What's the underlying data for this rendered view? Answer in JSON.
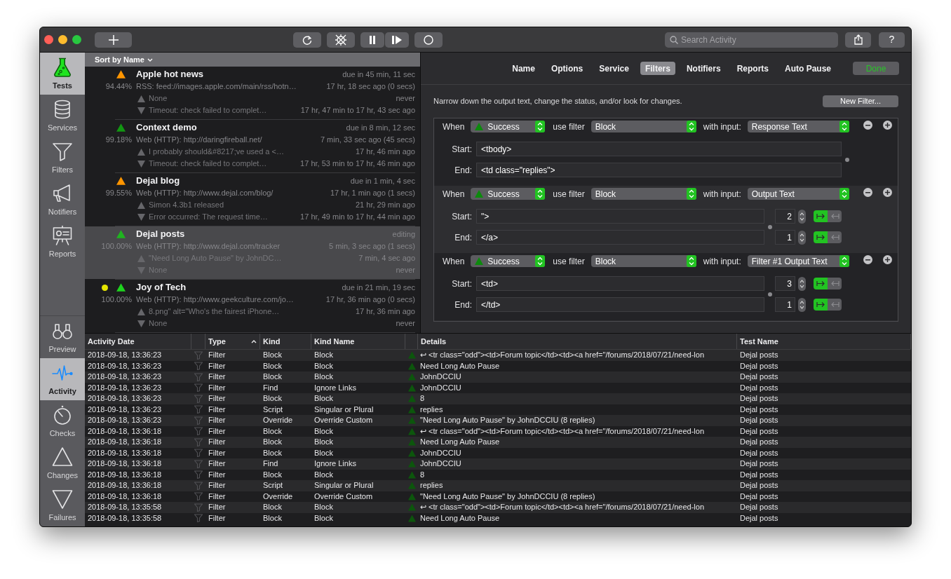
{
  "window": {
    "toolbar": {
      "search": {
        "placeholder": "Search Activity"
      },
      "help_label": "?"
    }
  },
  "sidebar": {
    "top_items": [
      {
        "label": "Tests",
        "selected": true
      },
      {
        "label": "Services",
        "selected": false
      },
      {
        "label": "Filters",
        "selected": false
      },
      {
        "label": "Notifiers",
        "selected": false
      },
      {
        "label": "Reports",
        "selected": false
      }
    ],
    "bottom_items": [
      {
        "label": "Preview",
        "selected": false
      },
      {
        "label": "Activity",
        "selected": true
      },
      {
        "label": "Checks",
        "selected": false
      },
      {
        "label": "Changes",
        "selected": false
      },
      {
        "label": "Failures",
        "selected": false
      }
    ]
  },
  "test_list": {
    "sort_label": "Sort by Name",
    "tests": [
      {
        "name": "Apple hot news",
        "color": "#ff9500",
        "marked": false,
        "selected": false,
        "percent": "94.44%",
        "schedule": "due in 45 min, 11 sec",
        "service": "RSS: feed://images.apple.com/main/rss/hotn…",
        "last_check": "17 hr, 18 sec ago (0 secs)",
        "change": "None",
        "change_time": "never",
        "failure": "Timeout: check failed to complet…",
        "failure_time": "17 hr, 47 min to 17 hr, 43 sec ago"
      },
      {
        "name": "Context demo",
        "color": "#129612",
        "marked": false,
        "selected": false,
        "percent": "99.18%",
        "schedule": "due in 8 min, 12 sec",
        "service": "Web (HTTP): http://daringfireball.net/",
        "last_check": "7 min, 33 sec ago (45 secs)",
        "change": "I probably should&#8217;ve used a <…",
        "change_time": "17 hr, 46 min ago",
        "failure": "Timeout: check failed to complet…",
        "failure_time": "17 hr, 53 min to 17 hr, 46 min ago"
      },
      {
        "name": "Dejal blog",
        "color": "#ff9500",
        "marked": false,
        "selected": false,
        "percent": "99.55%",
        "schedule": "due in 1 min, 4 sec",
        "service": "Web (HTTP): http://www.dejal.com/blog/",
        "last_check": "17 hr, 1 min ago (1 secs)",
        "change": "Simon 4.3b1 released",
        "change_time": "21 hr, 29 min ago",
        "failure": "Error occurred: The request time…",
        "failure_time": "17 hr, 49 min to 17 hr, 44 min ago"
      },
      {
        "name": "Dejal posts",
        "color": "#1fb41f",
        "marked": false,
        "selected": true,
        "percent": "100.00%",
        "schedule": "editing",
        "service": "Web (HTTP): http://www.dejal.com/tracker",
        "last_check": "5 min, 3 sec ago (1 secs)",
        "change": "\"Need Long Auto Pause\" by JohnDC…",
        "change_time": "7 min, 4 sec ago",
        "failure": "None",
        "failure_time": "never"
      },
      {
        "name": "Joy of Tech",
        "color": "#1ed21e",
        "marked": true,
        "selected": false,
        "percent": "100.00%",
        "schedule": "due in 21 min, 19 sec",
        "service": "Web (HTTP): http://www.geekculture.com/jo…",
        "last_check": "17 hr, 36 min ago (0 secs)",
        "change": "8.png\" alt=\"Who's the fairest iPhone…",
        "change_time": "17 hr, 36 min ago",
        "failure": "None",
        "failure_time": "never"
      }
    ]
  },
  "editor": {
    "tabs": [
      {
        "label": "Name",
        "selected": false
      },
      {
        "label": "Options",
        "selected": false
      },
      {
        "label": "Service",
        "selected": false
      },
      {
        "label": "Filters",
        "selected": true
      },
      {
        "label": "Notifiers",
        "selected": false
      },
      {
        "label": "Reports",
        "selected": false
      },
      {
        "label": "Auto Pause",
        "selected": false
      }
    ],
    "done_label": "Done",
    "description": "Narrow down the output text, change the status, and/or look for changes.",
    "new_filter_label": "New Filter...",
    "filters": [
      {
        "when_label": "When",
        "status": "Success",
        "use_label": "use filter",
        "filter": "Block",
        "input_label": "with input:",
        "input": "Response Text",
        "start_label": "Start:",
        "start": "<tbody>",
        "end_label": "End:",
        "end": "<td class=\"replies\">"
      },
      {
        "when_label": "When",
        "status": "Success",
        "use_label": "use filter",
        "filter": "Block",
        "input_label": "with input:",
        "input": "Output Text",
        "start_label": "Start:",
        "start": "\">",
        "end_label": "End:",
        "end": "</a>",
        "start_count": "2",
        "end_count": "1",
        "start_direction": [
          {
            "selected": true
          },
          {
            "selected": false
          }
        ],
        "end_direction": [
          {
            "selected": true
          },
          {
            "selected": false
          }
        ]
      },
      {
        "when_label": "When",
        "status": "Success",
        "use_label": "use filter",
        "filter": "Block",
        "input_label": "with input:",
        "input": "Filter #1 Output Text",
        "start_label": "Start:",
        "start": "<td>",
        "end_label": "End:",
        "end": "</td>",
        "start_count": "3",
        "end_count": "1",
        "start_direction": [
          {
            "selected": true
          },
          {
            "selected": false
          }
        ],
        "end_direction": [
          {
            "selected": true
          },
          {
            "selected": false
          }
        ]
      }
    ]
  },
  "activity": {
    "columns": [
      {
        "label": "Activity Date",
        "sorted": false
      },
      {
        "label": "Type",
        "sorted": true
      },
      {
        "label": "Kind",
        "sorted": false
      },
      {
        "label": "Kind Name",
        "sorted": false
      },
      {
        "label": "Details",
        "sorted": false
      },
      {
        "label": "Test Name",
        "sorted": false
      }
    ],
    "rows": [
      {
        "date": "2018-09-18, 13:36:23",
        "type": "Filter",
        "kind": "Block",
        "kind_name": "Block",
        "details": "↩ <tr class=\"odd\"><td>Forum topic</td><td><a href=\"/forums/2018/07/21/need-lon",
        "test_name": "Dejal posts"
      },
      {
        "date": "2018-09-18, 13:36:23",
        "type": "Filter",
        "kind": "Block",
        "kind_name": "Block",
        "details": "Need Long Auto Pause",
        "test_name": "Dejal posts"
      },
      {
        "date": "2018-09-18, 13:36:23",
        "type": "Filter",
        "kind": "Block",
        "kind_name": "Block",
        "details": "JohnDCCIU",
        "test_name": "Dejal posts"
      },
      {
        "date": "2018-09-18, 13:36:23",
        "type": "Filter",
        "kind": "Find",
        "kind_name": "Ignore Links",
        "details": "JohnDCCIU",
        "test_name": "Dejal posts"
      },
      {
        "date": "2018-09-18, 13:36:23",
        "type": "Filter",
        "kind": "Block",
        "kind_name": "Block",
        "details": "8",
        "test_name": "Dejal posts"
      },
      {
        "date": "2018-09-18, 13:36:23",
        "type": "Filter",
        "kind": "Script",
        "kind_name": "Singular or Plural",
        "details": "replies",
        "test_name": "Dejal posts"
      },
      {
        "date": "2018-09-18, 13:36:23",
        "type": "Filter",
        "kind": "Override",
        "kind_name": "Override Custom",
        "details": "\"Need Long Auto Pause\" by JohnDCCIU (8 replies)",
        "test_name": "Dejal posts"
      },
      {
        "date": "2018-09-18, 13:36:18",
        "type": "Filter",
        "kind": "Block",
        "kind_name": "Block",
        "details": "↩ <tr class=\"odd\"><td>Forum topic</td><td><a href=\"/forums/2018/07/21/need-lon",
        "test_name": "Dejal posts"
      },
      {
        "date": "2018-09-18, 13:36:18",
        "type": "Filter",
        "kind": "Block",
        "kind_name": "Block",
        "details": "Need Long Auto Pause",
        "test_name": "Dejal posts"
      },
      {
        "date": "2018-09-18, 13:36:18",
        "type": "Filter",
        "kind": "Block",
        "kind_name": "Block",
        "details": "JohnDCCIU",
        "test_name": "Dejal posts"
      },
      {
        "date": "2018-09-18, 13:36:18",
        "type": "Filter",
        "kind": "Find",
        "kind_name": "Ignore Links",
        "details": "JohnDCCIU",
        "test_name": "Dejal posts"
      },
      {
        "date": "2018-09-18, 13:36:18",
        "type": "Filter",
        "kind": "Block",
        "kind_name": "Block",
        "details": "8",
        "test_name": "Dejal posts"
      },
      {
        "date": "2018-09-18, 13:36:18",
        "type": "Filter",
        "kind": "Script",
        "kind_name": "Singular or Plural",
        "details": "replies",
        "test_name": "Dejal posts"
      },
      {
        "date": "2018-09-18, 13:36:18",
        "type": "Filter",
        "kind": "Override",
        "kind_name": "Override Custom",
        "details": "\"Need Long Auto Pause\" by JohnDCCIU (8 replies)",
        "test_name": "Dejal posts"
      },
      {
        "date": "2018-09-18, 13:35:58",
        "type": "Filter",
        "kind": "Block",
        "kind_name": "Block",
        "details": "↩ <tr class=\"odd\"><td>Forum topic</td><td><a href=\"/forums/2018/07/21/need-lon",
        "test_name": "Dejal posts"
      },
      {
        "date": "2018-09-18, 13:35:58",
        "type": "Filter",
        "kind": "Block",
        "kind_name": "Block",
        "details": "Need Long Auto Pause",
        "test_name": "Dejal posts"
      }
    ]
  }
}
